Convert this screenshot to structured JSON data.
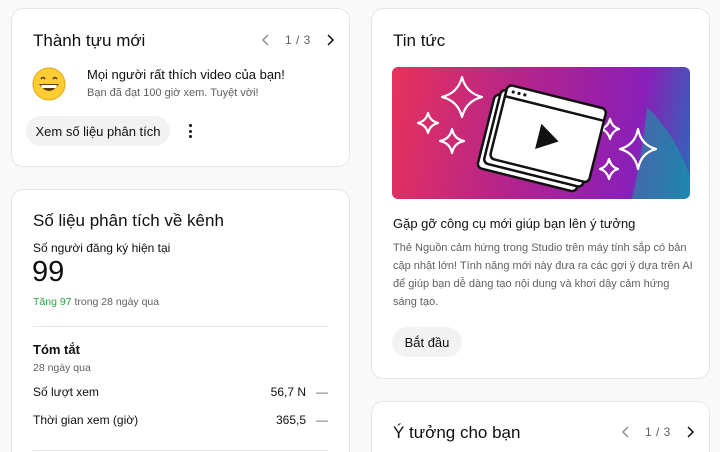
{
  "achievements": {
    "title": "Thành tựu mới",
    "pager": "1 / 3",
    "headline": "Mọi người rất thích video của bạn!",
    "subtext": "Bạn đã đạt 100 giờ xem. Tuyệt vời!",
    "button_label": "Xem số liệu phân tích"
  },
  "news": {
    "title": "Tin tức",
    "headline": "Gặp gỡ công cụ mới giúp bạn lên ý tưởng",
    "body": "Thẻ Nguồn cảm hứng trong Studio trên máy tính sắp có bản cập nhật lớn! Tính năng mới này đưa ra các gợi ý dựa trên AI để giúp bạn dễ dàng tạo nội dung và khơi dậy cảm hứng sáng tạo.",
    "button_label": "Bắt đầu"
  },
  "analytics": {
    "title": "Số liệu phân tích về kênh",
    "subscribers_label": "Số người đăng ký hiện tại",
    "subscribers_value": "99",
    "growth_value": "Tăng 97",
    "growth_period": "trong 28 ngày qua",
    "summary_title": "Tóm tắt",
    "summary_period": "28 ngày qua",
    "rows": [
      {
        "label": "Số lượt xem",
        "value": "56,7 N",
        "trend": "—"
      },
      {
        "label": "Thời gian xem (giờ)",
        "value": "365,5",
        "trend": "—"
      }
    ]
  },
  "ideas": {
    "title": "Ý tưởng cho bạn",
    "pager": "1 / 3"
  },
  "colors": {
    "growth_green": "#2ba640",
    "banner_gradient_start": "#e8325a",
    "banner_gradient_end": "#8a1fb8",
    "banner_teal": "#0fa3a3"
  }
}
